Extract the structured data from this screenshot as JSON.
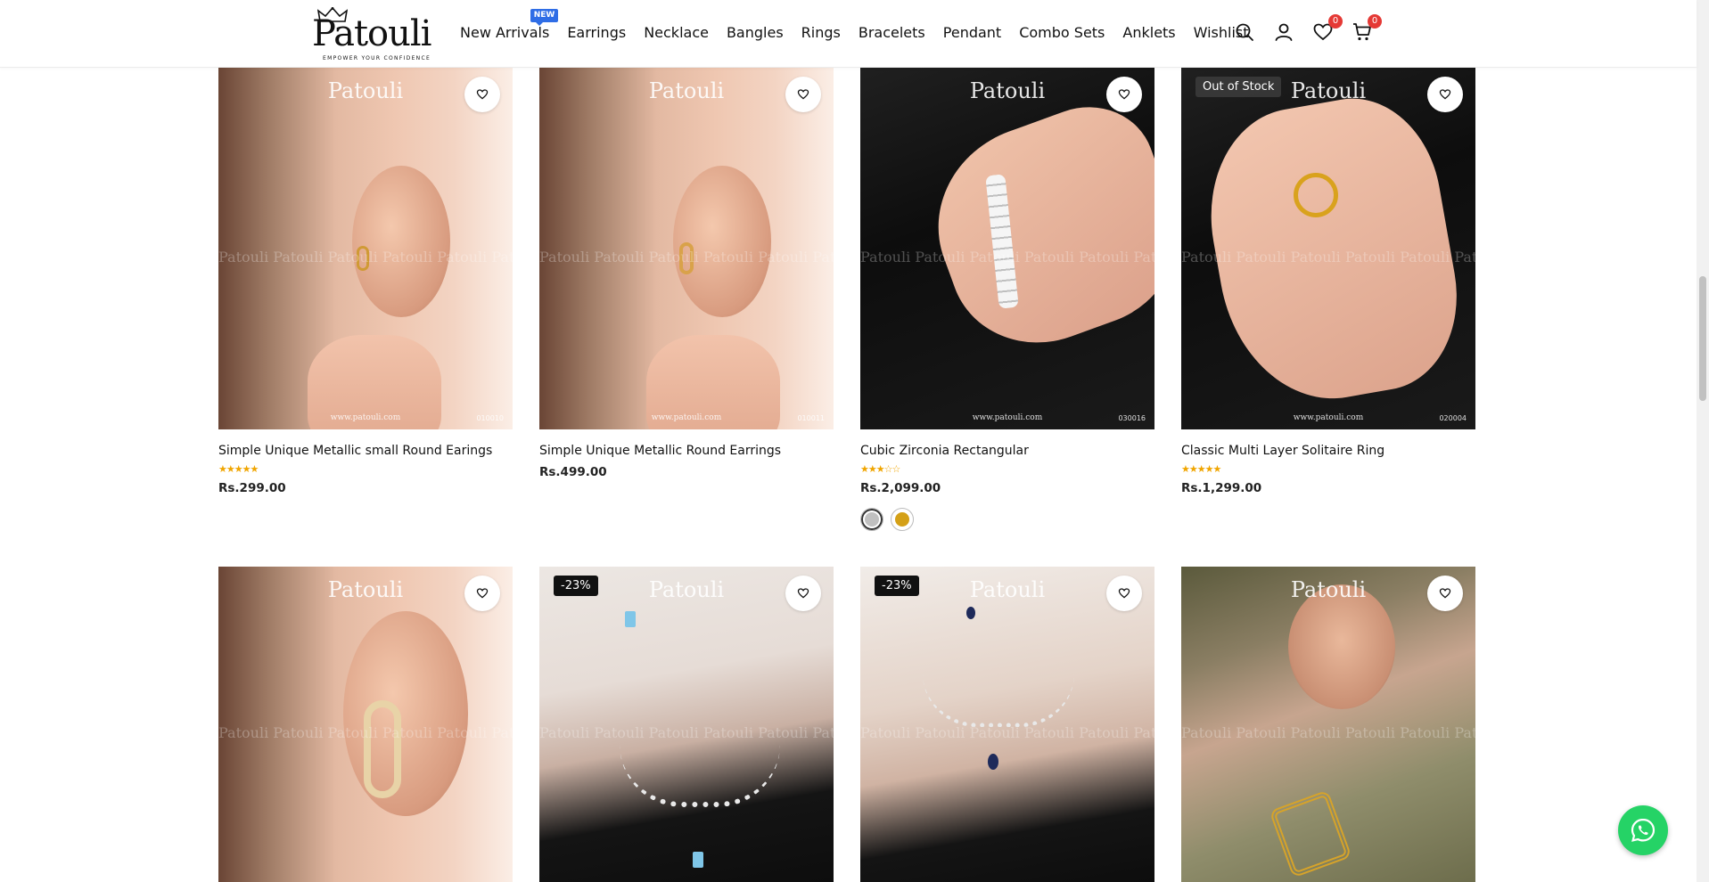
{
  "header": {
    "logo_text": "Patouli",
    "logo_tagline": "EMPOWER YOUR CONFIDENCE",
    "nav": [
      {
        "label": "New Arrivals",
        "badge": "NEW"
      },
      {
        "label": "Earrings"
      },
      {
        "label": "Necklace"
      },
      {
        "label": "Bangles"
      },
      {
        "label": "Rings"
      },
      {
        "label": "Bracelets"
      },
      {
        "label": "Pendant"
      },
      {
        "label": "Combo Sets"
      },
      {
        "label": "Anklets"
      },
      {
        "label": "Wishlist"
      }
    ],
    "wishlist_count": "0",
    "cart_count": "0"
  },
  "watermark": {
    "brand": "Patouli",
    "strip": "Patouli Patouli Patouli Patouli Patouli Patouli Patouli",
    "url": "www.patouli.com"
  },
  "products": [
    {
      "name": "Simple Unique Metallic small Round Earings",
      "rating": "★★★★★",
      "price": "Rs.299.00",
      "sku": "010010"
    },
    {
      "name": "Simple Unique Metallic Round Earrings",
      "price": "Rs.499.00",
      "sku": "010011"
    },
    {
      "name": "Cubic Zirconia Rectangular",
      "rating": "★★★☆☆",
      "price": "Rs.2,099.00",
      "sku": "030016",
      "swatches": [
        "#c0c0c0",
        "#d4a017"
      ]
    },
    {
      "name": "Classic Multi Layer Solitaire Ring",
      "rating": "★★★★★",
      "price": "Rs.1,299.00",
      "sku": "020004",
      "badge": "Out of Stock"
    },
    {
      "badge": null
    },
    {
      "badge": "-23%"
    },
    {
      "badge": "-23%"
    },
    {
      "badge": null
    }
  ],
  "colors": {
    "accent_badge": "#2f6de6",
    "count_badge": "#e53935",
    "star": "#f0a500",
    "whatsapp": "#25d366"
  }
}
